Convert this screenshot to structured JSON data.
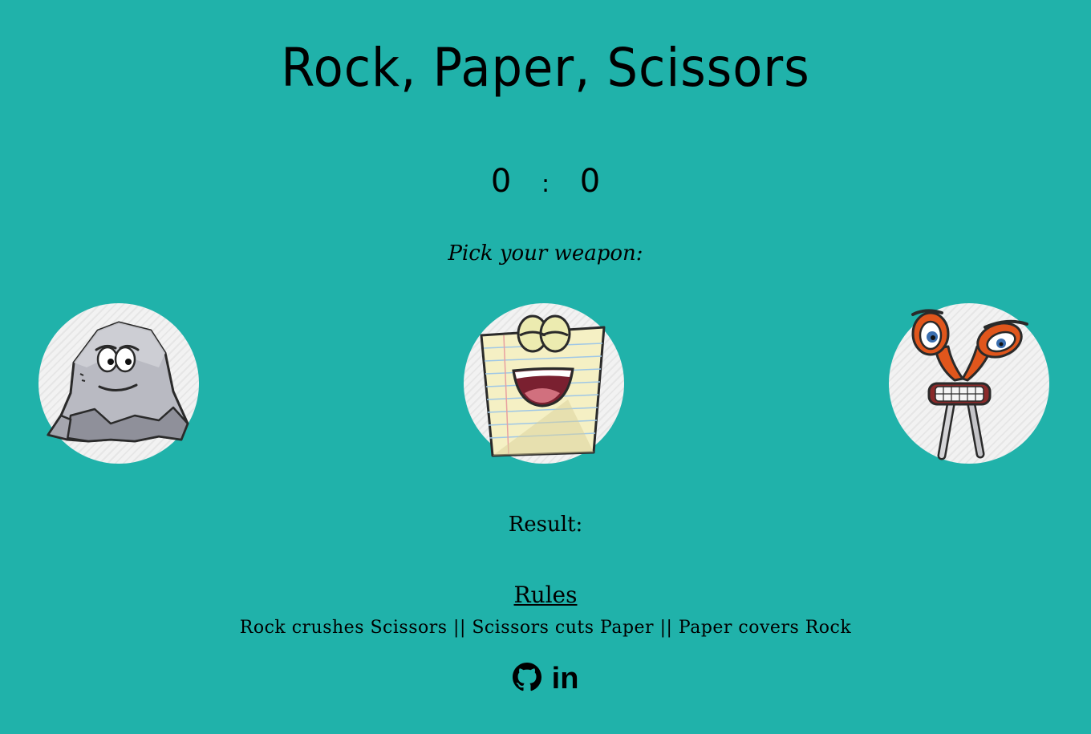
{
  "title": "Rock, Paper, Scissors",
  "score": {
    "player": "0",
    "separator": ":",
    "computer": "0"
  },
  "prompt": "Pick your weapon:",
  "weapons": [
    {
      "name": "rock",
      "icon": "rock-character-icon"
    },
    {
      "name": "paper",
      "icon": "paper-character-icon"
    },
    {
      "name": "scissors",
      "icon": "scissors-character-icon"
    }
  ],
  "result_label": "Result:",
  "rules": {
    "title": "Rules",
    "text": "Rock crushes Scissors || Scissors cuts Paper || Paper covers Rock"
  },
  "social": {
    "github_icon": "github-icon",
    "linkedin_icon": "linkedin-icon",
    "linkedin_glyph": "in"
  },
  "colors": {
    "background": "#20b2aa",
    "text": "#000000",
    "circle": "#f2f2f2"
  }
}
